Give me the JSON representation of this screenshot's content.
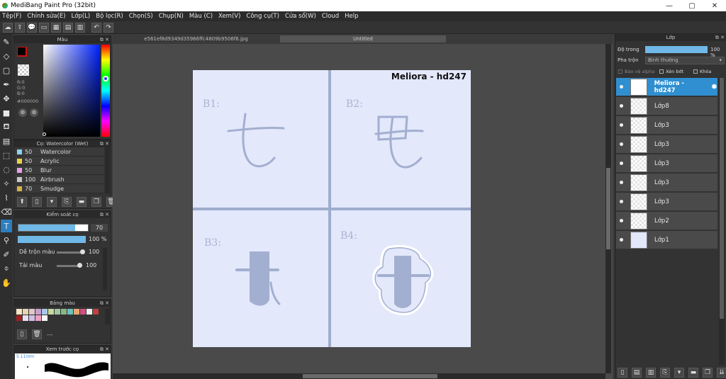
{
  "window": {
    "title": "MediBang Paint Pro (32bit)",
    "min": "—",
    "max": "▢",
    "close": "✕"
  },
  "menu": [
    "Tệp(F)",
    "Chỉnh sửa(E)",
    "Lớp(L)",
    "Bộ lọc(R)",
    "Chọn(S)",
    "Chụp(N)",
    "Màu (C)",
    "Xem(V)",
    "Công cụ(T)",
    "Cửa sổ(W)",
    "Cloud",
    "Help"
  ],
  "toolbar_icons": [
    "cloud-icon",
    "upload-icon",
    "comment-icon",
    "message-icon",
    "grid-icon",
    "grid2-icon",
    "grid3-icon",
    "undo-icon",
    "redo-icon"
  ],
  "color_panel": {
    "title": "Màu",
    "r": "R:0",
    "g": "G:0",
    "b": "B:0",
    "hex": "#000000",
    "fg": "#000000",
    "bg": "#ffffff"
  },
  "brush_panel": {
    "title": "Cọ: Watercolor (Wet)",
    "brushes": [
      {
        "size": "50",
        "name": "Watercolor",
        "color": "#8fd2f0"
      },
      {
        "size": "50",
        "name": "Acrylic",
        "color": "#e8d24a"
      },
      {
        "size": "50",
        "name": "Blur",
        "color": "#e8a0e8"
      },
      {
        "size": "100",
        "name": "Airbrush",
        "color": "#c8c8c8"
      },
      {
        "size": "70",
        "name": "Smudge",
        "color": "#d8b04a"
      }
    ]
  },
  "control_panel": {
    "title": "Kiểm soát cọ",
    "size_value": "70",
    "opacity_value": "100 %",
    "mix_label": "Dễ trộn màu",
    "mix_value": "100",
    "load_label": "Tải màu",
    "load_value": "100"
  },
  "palette_panel": {
    "title": "Bảng màu",
    "more": "---",
    "swatches": [
      "#f4e6c8",
      "#e8d4b0",
      "#e0c8c8",
      "#c8a0d0",
      "#a8c8e8",
      "#c8d8a0",
      "#a0c8a0",
      "#88b888",
      "#70c0c0",
      "#e8a870",
      "#d05080",
      "#f0f0f0",
      "#c04040",
      "#a02020",
      "#e8e0f0",
      "#d0c0e8",
      "#f0a0c0",
      "#f8f8f8"
    ]
  },
  "preview_panel": {
    "title": "Xem trước cọ",
    "size": "5.11mm"
  },
  "canvas": {
    "tabs": [
      "e561ef8d9349d35966ffc4809b9506f6.jpg",
      "Untitled"
    ],
    "watermark": "Meliora - hd247",
    "steps": [
      "B1:",
      "B2:",
      "B3:",
      "B4:"
    ]
  },
  "layer_panel": {
    "title": "Lớp",
    "opacity_label": "Độ trong",
    "opacity_value": "100 %",
    "opacity_fraction": 1.0,
    "blend_label": "Pha trộn",
    "blend_value": "Bình thường",
    "alpha_label": "Bảo vệ alpha",
    "clip_label": "Xén bớt",
    "lock_label": "Khóa",
    "layers": [
      {
        "name": "Meliora - hd247",
        "selected": true
      },
      {
        "name": "Lớp8",
        "selected": false
      },
      {
        "name": "Lớp3",
        "selected": false
      },
      {
        "name": "Lớp3",
        "selected": false
      },
      {
        "name": "Lớp3",
        "selected": false
      },
      {
        "name": "Lớp3",
        "selected": false
      },
      {
        "name": "Lớp3",
        "selected": false
      },
      {
        "name": "Lớp2",
        "selected": false
      },
      {
        "name": "Lớp1",
        "selected": false
      }
    ]
  }
}
